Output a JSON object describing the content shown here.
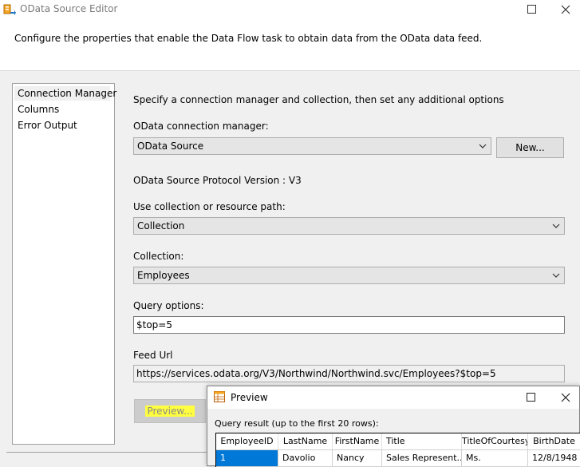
{
  "window": {
    "title": "OData Source Editor",
    "header_text": "Configure the properties that enable the Data Flow task to obtain data from the OData data feed."
  },
  "nav": {
    "items": [
      "Connection Manager",
      "Columns",
      "Error Output"
    ],
    "selected": "Connection Manager"
  },
  "main": {
    "intro": "Specify a connection manager and collection, then set any additional options",
    "conn_label": "OData connection manager:",
    "conn_value": "OData Source",
    "new_button": "New...",
    "protocol_text": "OData Source Protocol Version : V3",
    "use_label": "Use collection or resource path:",
    "use_value": "Collection",
    "collection_label": "Collection:",
    "collection_value": "Employees",
    "query_label": "Query options:",
    "query_value": "$top=5",
    "feed_label": "Feed Url",
    "feed_value": "https://services.odata.org/V3/Northwind/Northwind.svc/Employees?$top=5",
    "preview_button": "Preview..."
  },
  "preview": {
    "title": "Preview",
    "caption": "Query result (up to the first 20 rows):",
    "columns": [
      "EmployeeID",
      "LastName",
      "FirstName",
      "Title",
      "TitleOfCourtesy",
      "BirthDate"
    ],
    "rows": [
      [
        "1",
        "Davolio",
        "Nancy",
        "Sales Represent...",
        "Ms.",
        "12/8/1948"
      ]
    ]
  },
  "colors": {
    "selection": "#0078d7",
    "highlight": "#ffff40"
  }
}
